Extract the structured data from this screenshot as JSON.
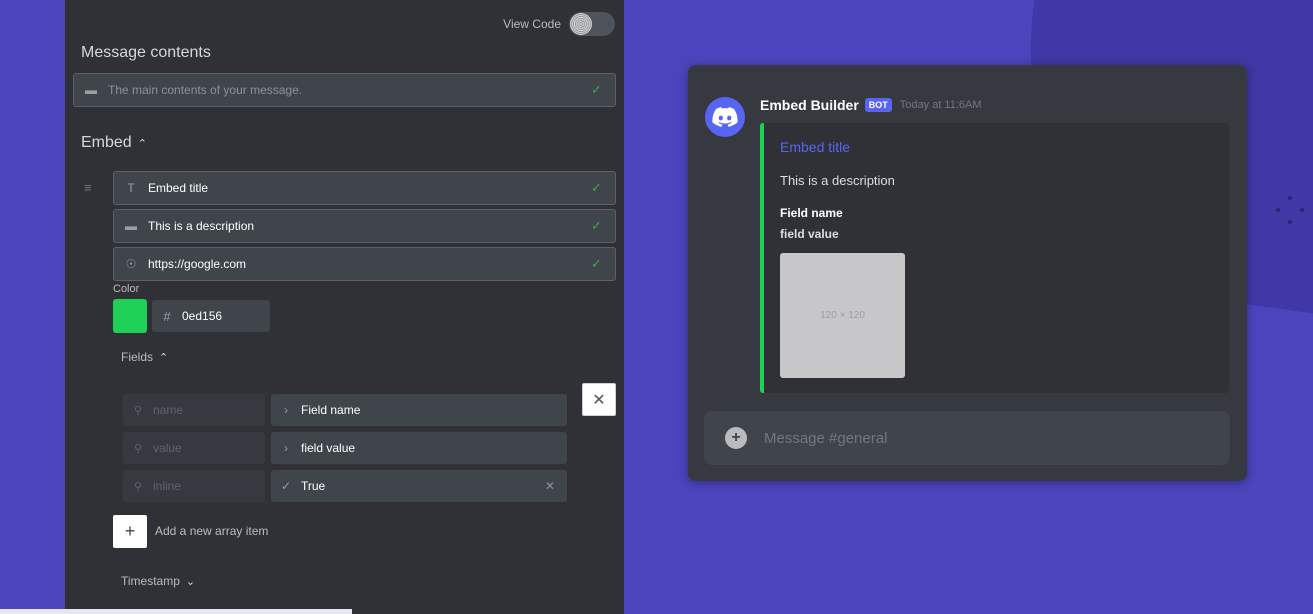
{
  "editor": {
    "view_code_label": "View Code",
    "message_contents_title": "Message contents",
    "content_placeholder": "The main contents of your message.",
    "embed_heading": "Embed",
    "embed_title_value": "Embed title",
    "description_value": "This is a description",
    "url_value": "https://google.com",
    "color_label": "Color",
    "color_hex": "0ed156",
    "fields_heading": "Fields",
    "fields": [
      {
        "key": "name",
        "value": "Field name"
      },
      {
        "key": "value",
        "value": "field value"
      },
      {
        "key": "inline",
        "value": "True"
      }
    ],
    "add_item_label": "Add a new array item",
    "timestamp_heading": "Timestamp"
  },
  "preview": {
    "username": "Embed Builder",
    "badge": "BOT",
    "timestamp": "Today at 11:6AM",
    "embed_title": "Embed title",
    "embed_description": "This is a description",
    "field_name": "Field name",
    "field_value": "field value",
    "image_placeholder": "120 × 120",
    "message_placeholder": "Message #general",
    "accent_color": "#1ed156"
  }
}
